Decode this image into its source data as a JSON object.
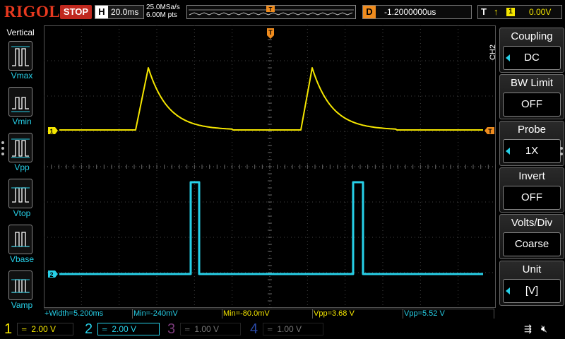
{
  "topbar": {
    "logo": "RIGOL",
    "run_state": "STOP",
    "horizontal_label": "H",
    "timebase": "20.0ms",
    "sample_rate": "25.0MSa/s",
    "memory_depth": "6.00M pts",
    "delay_label": "D",
    "delay_value": "-1.2000000us",
    "trigger_label": "T",
    "trigger_edge": "↑",
    "trigger_source": "1",
    "trigger_level": "0.00V"
  },
  "left_panel": {
    "title": "Vertical",
    "items": [
      {
        "label": "Vmax",
        "icon": "vmax-icon"
      },
      {
        "label": "Vmin",
        "icon": "vmin-icon"
      },
      {
        "label": "Vpp",
        "icon": "vpp-icon"
      },
      {
        "label": "Vtop",
        "icon": "vtop-icon"
      },
      {
        "label": "Vbase",
        "icon": "vbase-icon"
      },
      {
        "label": "Vamp",
        "icon": "vamp-icon"
      }
    ]
  },
  "right_menu": {
    "channel_tag": "CH2",
    "items": [
      {
        "title": "Coupling",
        "value": "DC",
        "has_selector": true
      },
      {
        "title": "BW Limit",
        "value": "OFF",
        "has_selector": false
      },
      {
        "title": "Probe",
        "value": "1X",
        "has_selector": true
      },
      {
        "title": "Invert",
        "value": "OFF",
        "has_selector": false
      },
      {
        "title": "Volts/Div",
        "value": "Coarse",
        "has_selector": false
      },
      {
        "title": "Unit",
        "value": "[V]",
        "has_selector": true
      }
    ]
  },
  "markers": {
    "ch1": "1",
    "ch2": "2",
    "trigger_pos": "T",
    "trigger_level": "T"
  },
  "measurements": [
    {
      "text": "+Width=5.200ms",
      "channel": 2
    },
    {
      "text": "Min=-240mV",
      "channel": 2
    },
    {
      "text": "Min=-80.0mV",
      "channel": 1
    },
    {
      "text": "Vpp=3.68 V",
      "channel": 1
    },
    {
      "text": "Vpp=5.52 V",
      "channel": 2
    }
  ],
  "channels": [
    {
      "number": "1",
      "scale": "2.00 V",
      "active": true,
      "color": "#f5e600"
    },
    {
      "number": "2",
      "scale": "2.00 V",
      "active": true,
      "color": "#27d0e8"
    },
    {
      "number": "3",
      "scale": "1.00 V",
      "active": false,
      "color": "#c040c0"
    },
    {
      "number": "4",
      "scale": "1.00 V",
      "active": false,
      "color": "#3060ff"
    }
  ],
  "status_icons": [
    "usb-icon",
    "speaker-mute-icon"
  ],
  "colors": {
    "ch1": "#f5e600",
    "ch2": "#27d0e8",
    "ch3": "#c040c0",
    "ch4": "#3060ff",
    "trigger": "#f08c1e",
    "stop": "#c0281e"
  }
}
